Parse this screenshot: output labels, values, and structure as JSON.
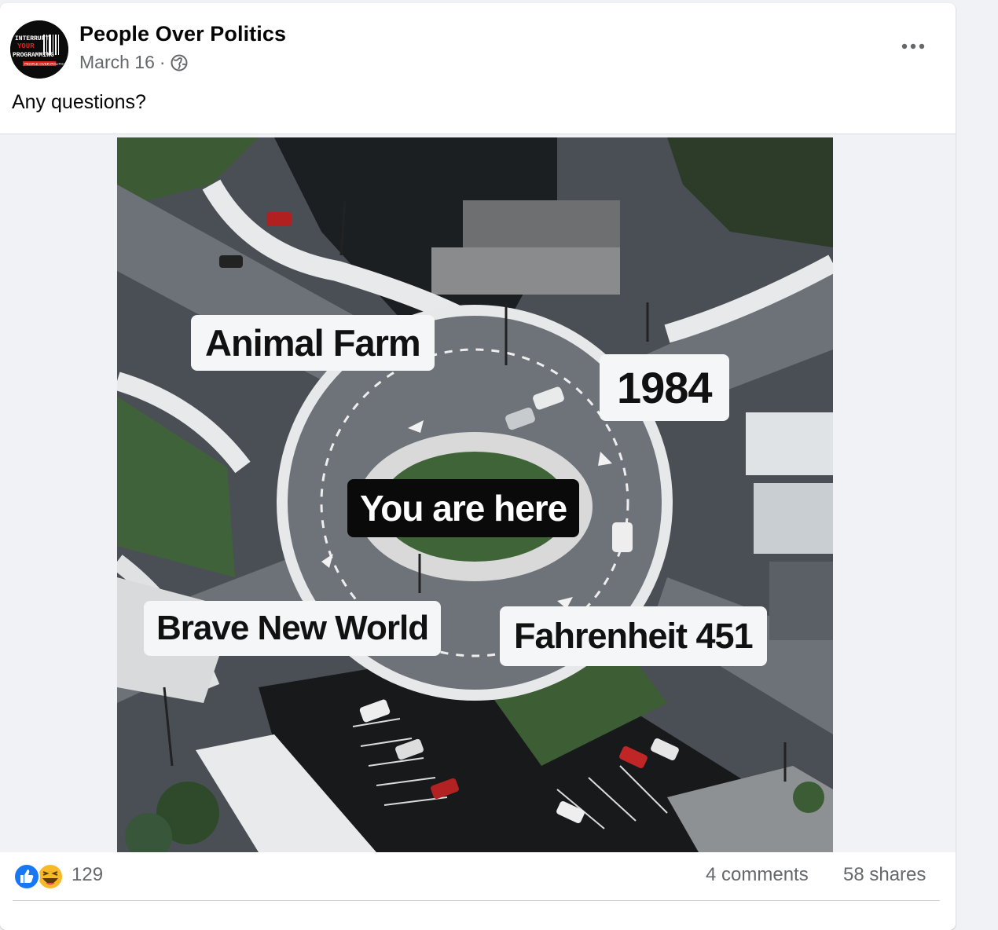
{
  "post": {
    "page_name": "People Over Politics",
    "date": "March 16",
    "separator": "·",
    "privacy_icon": "globe-icon",
    "more_icon": "more-horizontal-icon",
    "text": "Any questions?",
    "avatar": {
      "logo_line1": "INTERRUPT",
      "logo_line2": "YOUR",
      "logo_line3": "PROGRAMMING",
      "logo_line4": "PEOPLE OVER POLITICS"
    }
  },
  "image": {
    "labels": {
      "animal_farm": "Animal Farm",
      "nineteen_eighty_four": "1984",
      "you_are_here": "You are here",
      "brave_new_world": "Brave New World",
      "fahrenheit": "Fahrenheit 451"
    }
  },
  "stats": {
    "reaction_icons": [
      "like-icon",
      "haha-icon"
    ],
    "reaction_count": "129",
    "comments": "4 comments",
    "shares": "58 shares"
  },
  "colors": {
    "like_blue": "#1877f2",
    "haha_yellow": "#f7b928",
    "meta_gray": "#65676b"
  }
}
